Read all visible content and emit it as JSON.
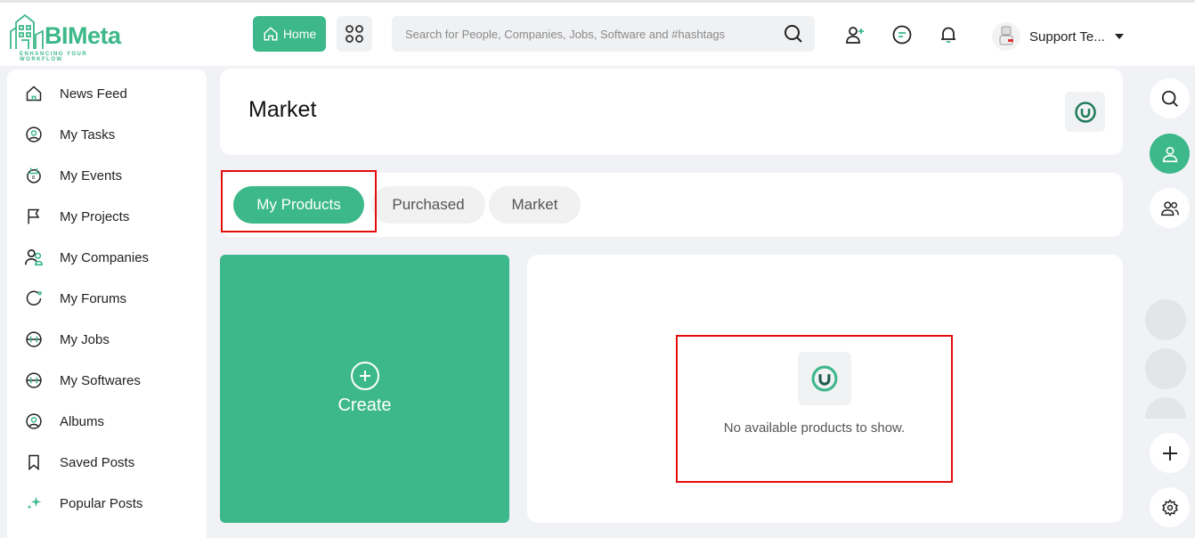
{
  "brand": {
    "name": "BIMeta",
    "tagline": "ENHANCING YOUR WORKFLOW",
    "accent": "#3cb88a"
  },
  "header": {
    "home_label": "Home",
    "search_placeholder": "Search for People, Companies, Jobs, Software and #hashtags",
    "user_name": "Support Te..."
  },
  "sidebar": {
    "items": [
      {
        "label": "News Feed",
        "icon": "home-icon"
      },
      {
        "label": "My Tasks",
        "icon": "tasks-icon"
      },
      {
        "label": "My Events",
        "icon": "calendar-icon"
      },
      {
        "label": "My Projects",
        "icon": "flag-icon"
      },
      {
        "label": "My Companies",
        "icon": "companies-icon"
      },
      {
        "label": "My Forums",
        "icon": "forum-icon"
      },
      {
        "label": "My Jobs",
        "icon": "jobs-icon"
      },
      {
        "label": "My Softwares",
        "icon": "software-icon"
      },
      {
        "label": "Albums",
        "icon": "album-icon"
      },
      {
        "label": "Saved Posts",
        "icon": "bookmark-icon"
      },
      {
        "label": "Popular Posts",
        "icon": "sparkle-icon"
      }
    ]
  },
  "main": {
    "title": "Market",
    "tabs": [
      {
        "label": "My Products",
        "active": true
      },
      {
        "label": "Purchased",
        "active": false
      },
      {
        "label": "Market",
        "active": false
      }
    ],
    "create_label": "Create",
    "empty_message": "No available products to show."
  },
  "colors": {
    "highlight": "#e30c0c",
    "background": "#f0f2f5"
  }
}
